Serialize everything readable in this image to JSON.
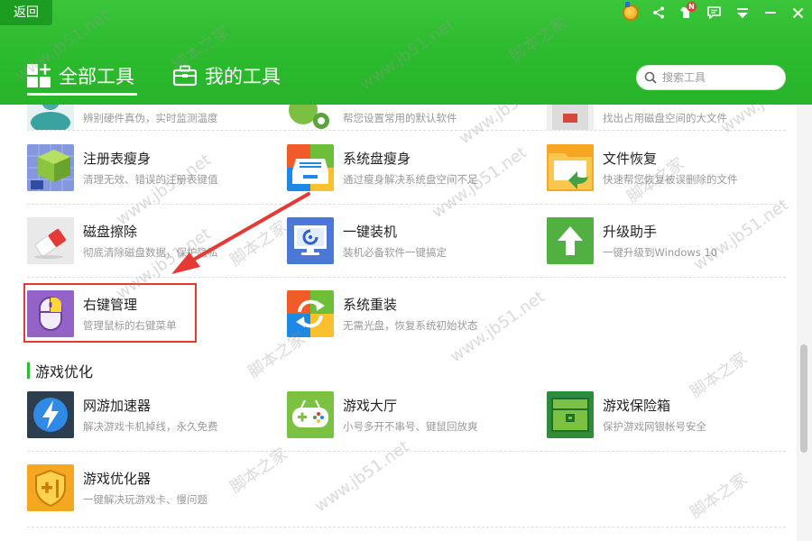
{
  "header": {
    "back_label": "返回",
    "notification_badge": "N",
    "tabs": [
      {
        "label": "全部工具",
        "active": true
      },
      {
        "label": "我的工具",
        "active": false
      }
    ],
    "search": {
      "placeholder": "搜索工具"
    },
    "accent_color": "#2dbb2f"
  },
  "partial_row": [
    {
      "desc": "辨别硬件真伪，实时监测温度"
    },
    {
      "desc": "帮您设置常用的默认软件"
    },
    {
      "desc": "找出占用磁盘空间的大文件"
    }
  ],
  "rows": [
    [
      {
        "name": "注册表瘦身",
        "desc": "清理无效、错误的注册表键值",
        "icon": "registry-cube-icon"
      },
      {
        "name": "系统盘瘦身",
        "desc": "通过瘦身解决系统盘空间不足",
        "icon": "disk-tray-icon"
      },
      {
        "name": "文件恢复",
        "desc": "快速帮您恢复被误删除的文件",
        "icon": "folder-restore-icon"
      }
    ],
    [
      {
        "name": "磁盘擦除",
        "desc": "彻底清除磁盘数据，保护隐私",
        "icon": "eraser-icon"
      },
      {
        "name": "一键装机",
        "desc": "装机必备软件一键搞定",
        "icon": "monitor-install-icon"
      },
      {
        "name": "升级助手",
        "desc": "一键升级到Windows 10",
        "icon": "upgrade-arrow-icon"
      }
    ],
    [
      {
        "name": "右键管理",
        "desc": "管理鼠标的右键菜单",
        "icon": "mouse-icon"
      },
      {
        "name": "系统重装",
        "desc": "无需光盘，恢复系统初始状态",
        "icon": "refresh-windows-icon"
      }
    ]
  ],
  "section_game": {
    "title": "游戏优化",
    "rows": [
      [
        {
          "name": "网游加速器",
          "desc": "解决游戏卡机掉线，永久免费",
          "icon": "lightning-icon"
        },
        {
          "name": "游戏大厅",
          "desc": "小号多开不串号、键鼠回放爽",
          "icon": "gamepad-icon"
        },
        {
          "name": "游戏保险箱",
          "desc": "保护游戏网银帐号安全",
          "icon": "safe-box-icon"
        }
      ],
      [
        {
          "name": "游戏优化器",
          "desc": "一键解决玩游戏卡、慢问题",
          "icon": "shield-plus-icon"
        }
      ]
    ]
  },
  "watermark": {
    "site": "www.jb51.net",
    "brand": "脚本之家"
  }
}
